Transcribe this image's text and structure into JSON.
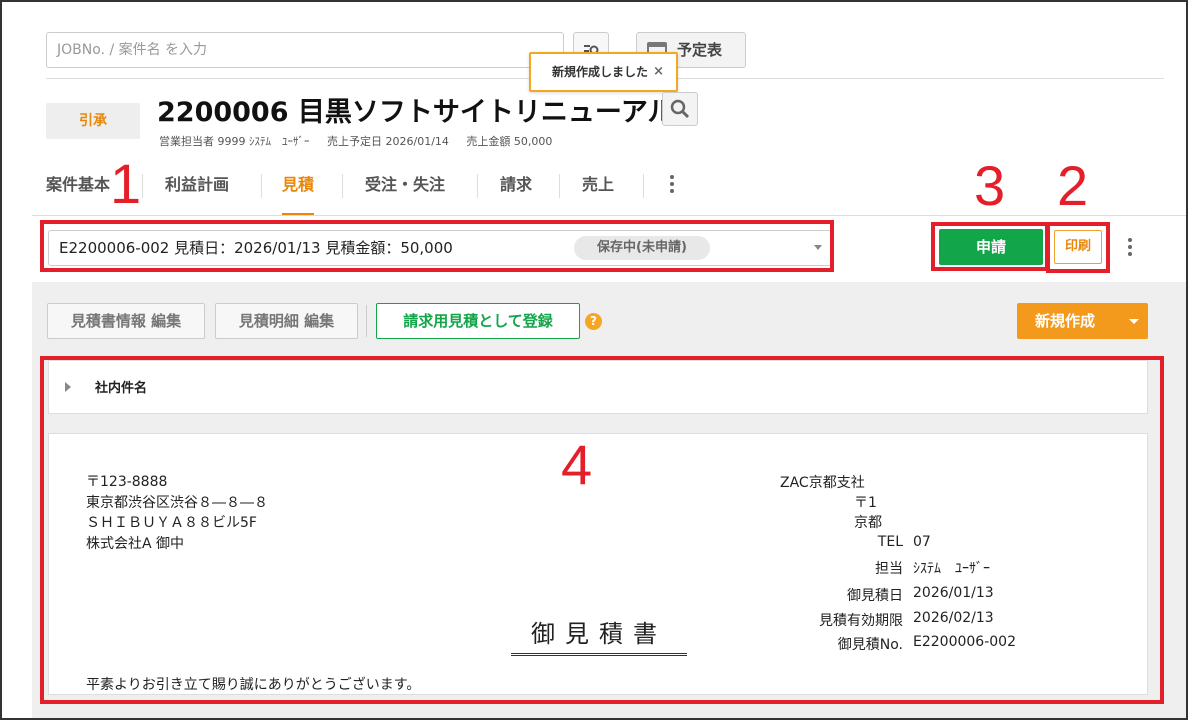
{
  "search": {
    "placeholder": "JOBNo. / 案件名 を入力",
    "schedule_label": "予定表"
  },
  "toast": {
    "message": "新規作成しました",
    "close": "×"
  },
  "project": {
    "stage": "引承",
    "title": "2200006 目黒ソフトサイトリニューアル",
    "meta": [
      "営業担当者 9999 ｼｽﾃﾑ　ﾕｰｻﾞｰ",
      "売上予定日 2026/01/14",
      "売上金額 50,000"
    ]
  },
  "tabs": [
    "案件基本",
    "利益計画",
    "見積",
    "受注・失注",
    "請求",
    "売上"
  ],
  "estimate": {
    "selected": "E2200006-002 見積日：2026/01/13 見積金額：50,000",
    "status": "保存中(未申請)",
    "apply_label": "申請",
    "print_label": "印刷"
  },
  "toolbar": {
    "edit_info": "見積書情報 編集",
    "edit_detail": "見積明細 編集",
    "register": "請求用見積として登録",
    "help": "?",
    "new_label": "新規作成"
  },
  "internal_panel": {
    "label": "社内件名"
  },
  "document": {
    "recipient": [
      "〒123-8888",
      "東京都渋谷区渋谷８―８―８",
      "ＳＨＩＢＵＹＡ８８ビル5F",
      "株式会社A 御中"
    ],
    "sender_company": "ZAC京都支社",
    "postal": "〒1",
    "city": "京都",
    "tel_label": "TEL",
    "tel_value": "07",
    "staff_label": "担当",
    "staff_value": "ｼｽﾃﾑ　ﾕｰｻﾞｰ",
    "date_label": "御見積日",
    "date_value": "2026/01/13",
    "valid_label": "見積有効期限",
    "valid_value": "2026/02/13",
    "no_label": "御見積No.",
    "no_value": "E2200006-002",
    "title": "御見積書",
    "greeting": "平素よりお引き立て賜り誠にありがとうございます。"
  },
  "annotations": [
    "1",
    "2",
    "3",
    "4"
  ],
  "colors": {
    "accent": "#e8870a",
    "apply": "#13a54a",
    "annotation": "#e3202a",
    "new_button": "#f39a1c"
  }
}
